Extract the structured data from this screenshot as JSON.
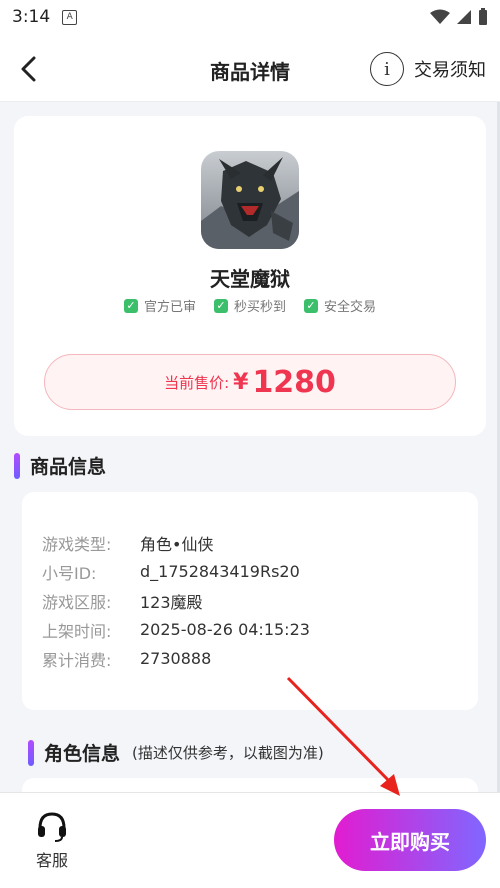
{
  "status_bar": {
    "time": "3:14",
    "notif_icon_text": "A"
  },
  "header": {
    "title": "商品详情",
    "notice_label": "交易须知",
    "notice_icon_char": "i"
  },
  "product": {
    "name": "天堂魔狱",
    "tags": [
      "官方已审",
      "秒买秒到",
      "安全交易"
    ],
    "price_label": "当前售价:",
    "price_currency": "¥",
    "price_value": "1280"
  },
  "info_section": {
    "title": "商品信息",
    "rows": [
      {
        "key": "游戏类型:",
        "value": "角色•仙侠"
      },
      {
        "key": "小号ID:",
        "value": "d_1752843419Rs20"
      },
      {
        "key": "游戏区服:",
        "value": "123魔殿"
      },
      {
        "key": "上架时间:",
        "value": "2025-08-26 04:15:23"
      },
      {
        "key": "累计消费:",
        "value": "2730888"
      }
    ]
  },
  "role_section": {
    "title": "角色信息",
    "subtitle": "(描述仅供参考，以截图为准)"
  },
  "bottom": {
    "service_label": "客服",
    "buy_label": "立即购买"
  },
  "colors": {
    "accent_red": "#ef3550",
    "check_green": "#3bbf6a",
    "gradient_start": "#e21cd0",
    "gradient_end": "#8067ff"
  },
  "icons": {
    "back": "chevron-left-icon",
    "notice": "info-circle-icon",
    "service": "headset-icon",
    "check": "checkbox-icon"
  }
}
